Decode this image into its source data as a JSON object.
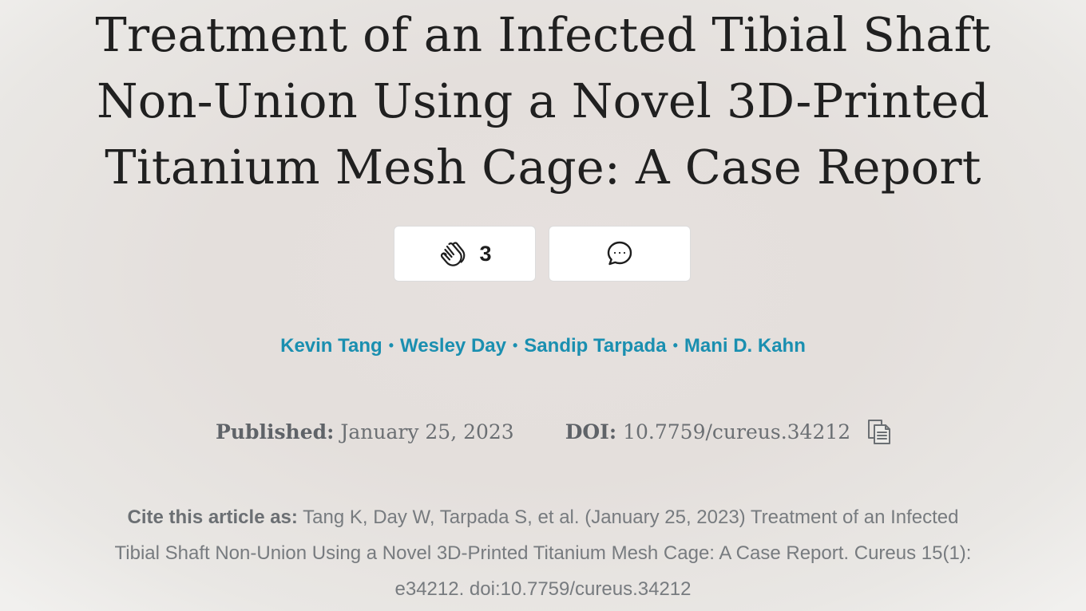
{
  "article": {
    "title": "Treatment of an Infected Tibial Shaft Non-Union Using a Novel 3D-Printed Titanium Mesh Cage: A Case Report",
    "title_lines": [
      "Treatment of an Infected Tibial Shaft",
      "Non-Union Using a Novel 3D-Printed",
      "Titanium Mesh Cage: A Case Report"
    ]
  },
  "actions": {
    "clap_icon": "clap-icon",
    "clap_count": "3",
    "comment_icon": "comment-icon"
  },
  "authors": [
    {
      "name": "Kevin Tang"
    },
    {
      "name": "Wesley Day"
    },
    {
      "name": "Sandip Tarpada"
    },
    {
      "name": "Mani D. Kahn"
    }
  ],
  "author_separator": "•",
  "meta": {
    "published_label": "Published:",
    "published_value": "January 25, 2023",
    "doi_label": "DOI:",
    "doi_value": "10.7759/cureus.34212",
    "copy_icon": "copy-icon"
  },
  "citation": {
    "label": "Cite this article as:",
    "text": "Tang K, Day W, Tarpada S, et al. (January 25, 2023) Treatment of an Infected Tibial Shaft Non-Union Using a Novel 3D-Printed Titanium Mesh Cage: A Case Report. Cureus 15(1): e34212. doi:10.7759/cureus.34212"
  },
  "colors": {
    "author_link": "#1a8fb0",
    "title_text": "#202020",
    "meta_text": "#6b6f73",
    "button_bg": "#ffffff"
  }
}
